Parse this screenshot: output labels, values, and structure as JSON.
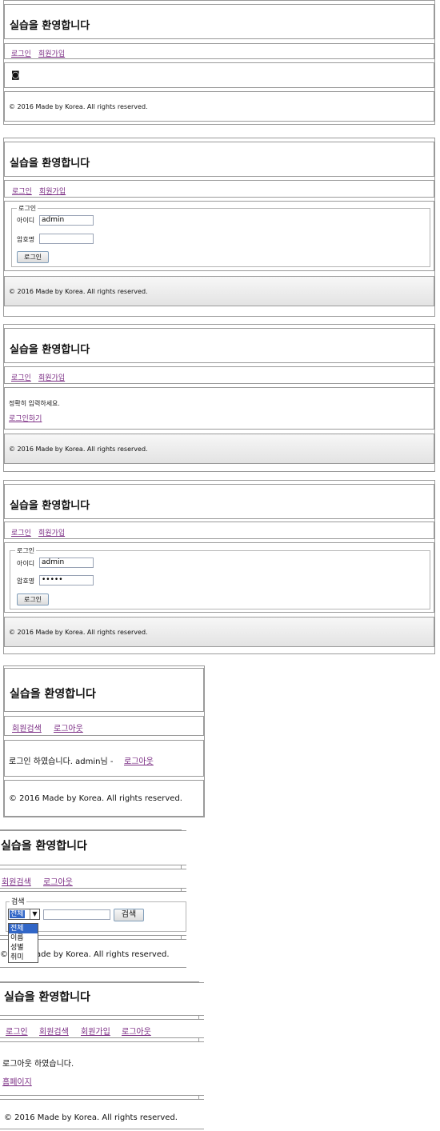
{
  "site_title": "실습을 환영합니다",
  "footer_text": "© 2016 Made by Korea. All rights reserved.",
  "nav": {
    "login": "로그인",
    "join": "회원가입",
    "search": "회원검색",
    "logout": "로그아웃"
  },
  "panel1": {
    "broken_image_glyph": "◙"
  },
  "panel2": {
    "legend": "로그인",
    "id_label": "아이디",
    "id_value": "admin",
    "pw_label": "암호명",
    "pw_value": "",
    "login_button": "로그인"
  },
  "panel3": {
    "message": "정확히 입력하세요.",
    "link": "로그인하기"
  },
  "panel4": {
    "legend": "로그인",
    "id_label": "아이디",
    "id_value": "admin",
    "pw_label": "암호명",
    "pw_value": "•••••",
    "login_button": "로그인"
  },
  "panel5": {
    "message_prefix": "로그인 하였습니다. admin님 -",
    "logout_link": "로그아웃"
  },
  "panel6": {
    "legend": "검색",
    "select_value": "전체",
    "options": [
      "전체",
      "이름",
      "성별",
      "취미"
    ],
    "search_button": "검색",
    "footer_visible": "ade by Korea. All rights reserved.",
    "footer_prefix": "©"
  },
  "panel7": {
    "message": "로그아웃 하였습니다.",
    "home_link": "홈페이지"
  },
  "colors": {
    "link": "#7a2b83",
    "border": "#9a9a9a",
    "select_highlight": "#3166c7"
  }
}
